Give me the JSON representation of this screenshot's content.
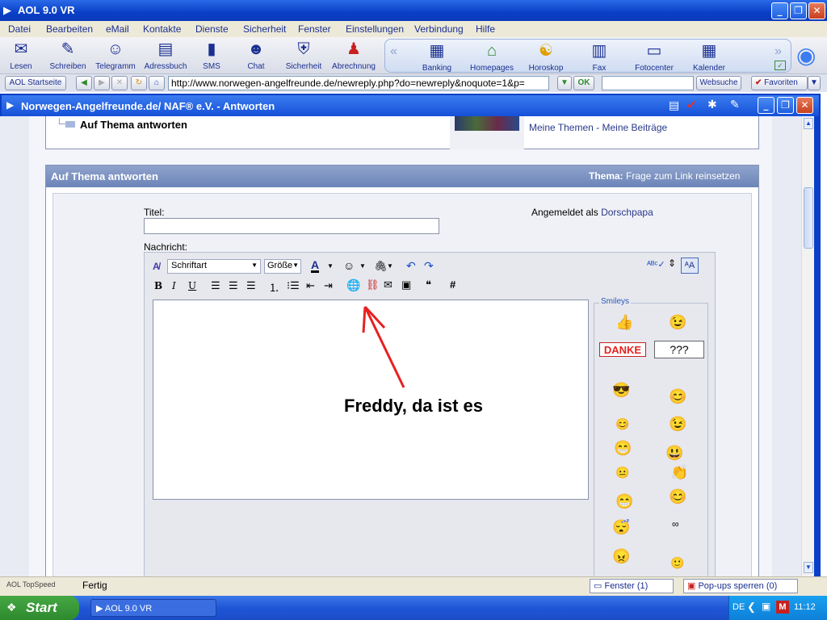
{
  "app": {
    "title": "AOL 9.0 VR"
  },
  "menu": [
    "Datei",
    "Bearbeiten",
    "eMail",
    "Kontakte",
    "Dienste",
    "Sicherheit",
    "Fenster",
    "Einstellungen",
    "Verbindung",
    "Hilfe"
  ],
  "toolbar_left": [
    {
      "label": "Lesen",
      "icon": "✉"
    },
    {
      "label": "Schreiben",
      "icon": "✎"
    },
    {
      "label": "Telegramm",
      "icon": "☺"
    },
    {
      "label": "Adressbuch",
      "icon": "▤"
    },
    {
      "label": "SMS",
      "icon": "▮"
    },
    {
      "label": "Chat",
      "icon": "☻"
    },
    {
      "label": "Sicherheit",
      "icon": "⛨"
    },
    {
      "label": "Abrechnung",
      "icon": "♟"
    }
  ],
  "toolbar_right": [
    {
      "label": "Banking",
      "icon": "▦"
    },
    {
      "label": "Homepages",
      "icon": "⌂"
    },
    {
      "label": "Horoskop",
      "icon": "☯"
    },
    {
      "label": "Fax",
      "icon": "▥"
    },
    {
      "label": "Fotocenter",
      "icon": "▭"
    },
    {
      "label": "Kalender",
      "icon": "▦"
    }
  ],
  "addressbar": {
    "home_label": "AOL Startseite",
    "url": "http://www.norwegen-angelfreunde.de/newreply.php?do=newreply&noquote=1&p=",
    "ok_label": "OK",
    "search_value": "",
    "search_button": "Websuche",
    "favorites_label": "Favoriten"
  },
  "inner_window": {
    "title": "Norwegen-Angelfreunde.de/ NAF® e.V. - Antworten"
  },
  "navbox": {
    "breadcrumb": "Auf Thema antworten",
    "links": "Meine Themen - Meine Beiträge"
  },
  "panel": {
    "heading": "Auf Thema antworten",
    "thema_label": "Thema:",
    "thema_value": "Frage zum Link reinsetzen",
    "titel_label": "Titel:",
    "titel_value": "",
    "logged_in_label": "Angemeldet als",
    "logged_in_user": "Dorschpapa",
    "nachricht_label": "Nachricht:"
  },
  "editor": {
    "font_select": "Schriftart",
    "size_select": "Größe",
    "annotation": "Freddy, da ist es",
    "smileys_label": "Smileys",
    "smileys": [
      "👍",
      "😉",
      "DANKE",
      "???",
      "😎",
      "😊",
      "😊",
      "😉",
      "😁",
      "😃",
      "😐",
      "👏",
      "😁",
      "😊",
      "😴",
      "∞",
      "😠",
      "🙂",
      "😊",
      "😁",
      "😊",
      "😊"
    ]
  },
  "status": {
    "topspeed": "AOL TopSpeed",
    "text": "Fertig",
    "fenster": "Fenster (1)",
    "popups": "Pop-ups sperren (0)"
  },
  "taskbar": {
    "start": "Start",
    "task": "AOL 9.0 VR",
    "lang": "DE",
    "clock": "11:12"
  }
}
